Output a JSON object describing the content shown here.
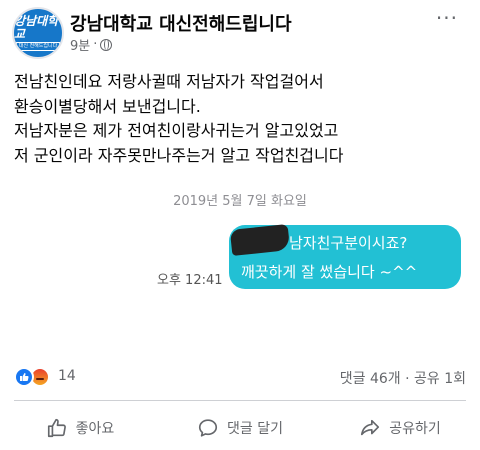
{
  "post": {
    "page_name": "강남대학교 대신전해드립니다",
    "time": "9분",
    "separator": "·",
    "avatar": {
      "logo_main": "강남대학교",
      "logo_sub": "대신 전해드립니다"
    },
    "more_icon": "more-dots-icon",
    "lines": [
      "전남친인데요 저랑사귈때 저남자가 작업걸어서",
      "환승이별당해서 보낸겁니다.",
      "저남자분은 제가 전여친이랑사귀는거 알고있었고",
      "저 군인이라 자주못만나주는거 알고 작업친겁니다"
    ]
  },
  "chat": {
    "date": "2019년 5월 7일 화요일",
    "time": "오후 12:41",
    "bubble_line1": "남자친구분이시죠?",
    "bubble_line2": "깨끗하게 잘 썼습니다 ~^^",
    "bubble_color": "#22c0d4"
  },
  "reactions": {
    "count": "14",
    "engagement": "댓글 46개 · 공유 1회",
    "icons": [
      "like-icon",
      "angry-icon"
    ]
  },
  "actions": {
    "like": "좋아요",
    "comment": "댓글 달기",
    "share": "공유하기"
  },
  "colors": {
    "accent": "#1877f2",
    "muted": "#65676b"
  }
}
